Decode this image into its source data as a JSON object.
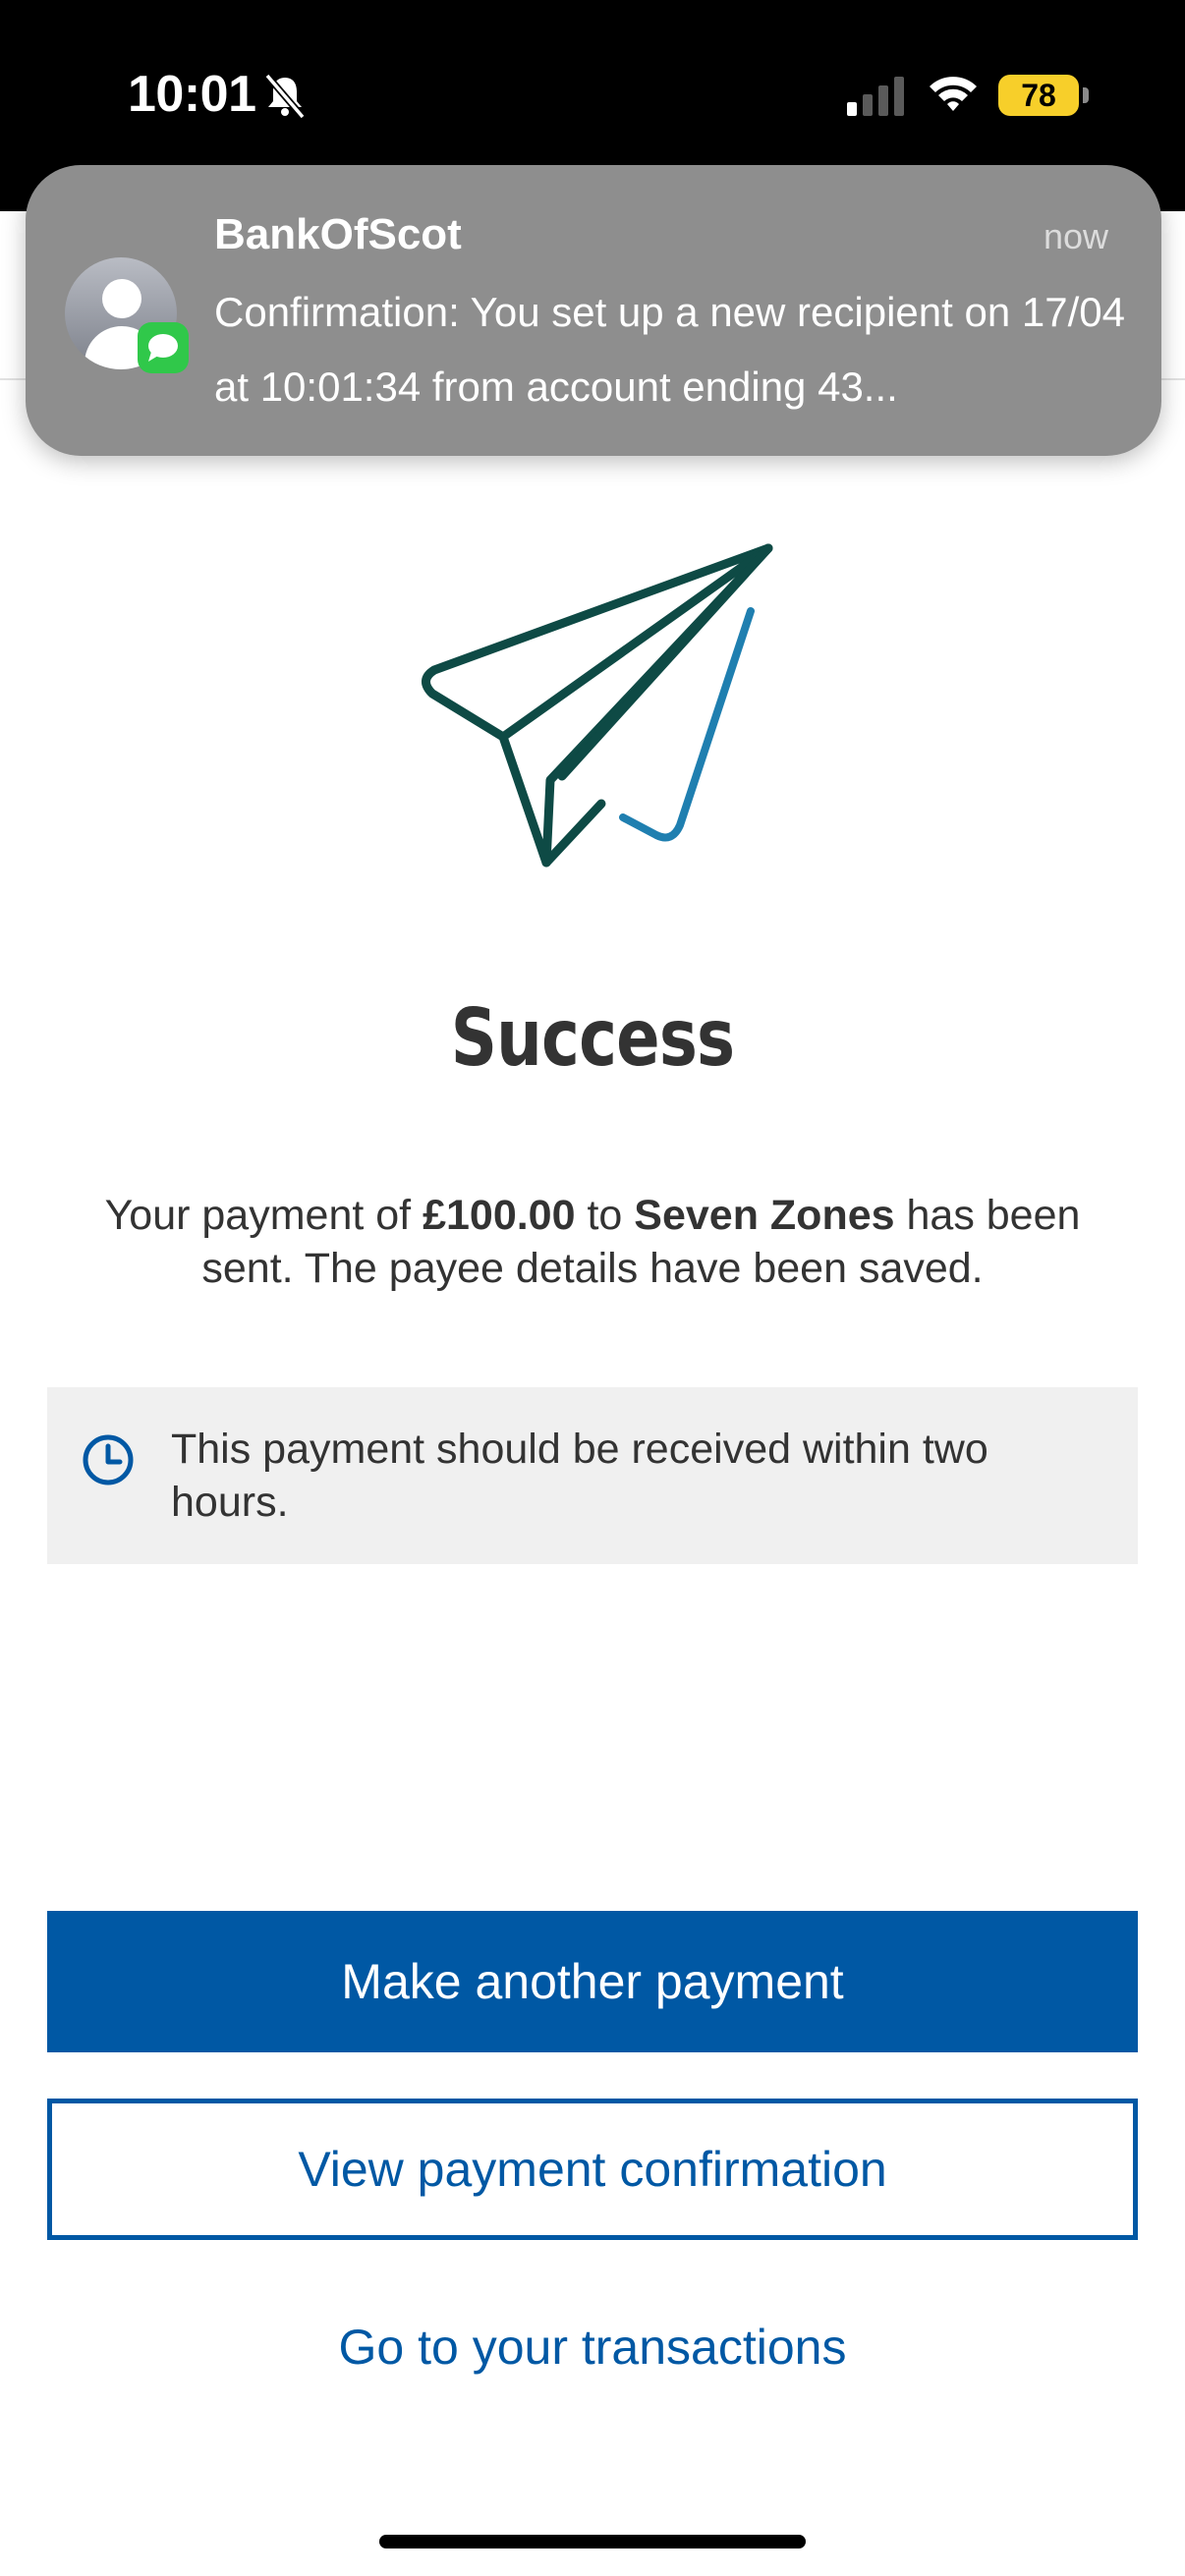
{
  "status_bar": {
    "time": "10:01",
    "battery": "78",
    "battery_color": "#f7cf2a"
  },
  "notification": {
    "app_name": "BankOfScot",
    "time": "now",
    "body": "Confirmation: You set up a new recipient on 17/04 at 10:01:34 from account ending 43...",
    "avatar_icon": "contact-avatar-icon",
    "badge_icon": "messages-icon"
  },
  "main": {
    "illustration_icon": "paper-plane-icon",
    "title": "Success",
    "message": {
      "part1": "Your payment of ",
      "amount": "£100.00",
      "part2": " to ",
      "payee": "Seven Zones",
      "part3": " has been sent. The payee details have been saved."
    },
    "info": {
      "icon": "clock-icon",
      "text": "This payment should be received within two hours."
    }
  },
  "actions": {
    "primary": "Make another payment",
    "secondary": "View payment confirmation",
    "link": "Go to your transactions"
  },
  "colors": {
    "brand_blue": "#0058a4",
    "plane_dark": "#0e4a45",
    "plane_accent": "#1f7fb0",
    "info_bg": "#f0f0f0"
  }
}
